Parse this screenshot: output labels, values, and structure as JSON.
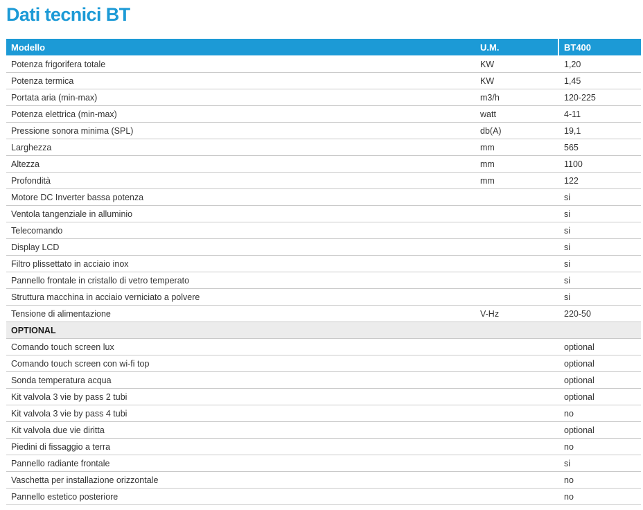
{
  "title": "Dati tecnici BT",
  "header": {
    "model": "Modello",
    "unit": "U.M.",
    "product": "BT400"
  },
  "specs": [
    {
      "label": "Potenza frigorifera totale",
      "unit": "KW",
      "value": "1,20"
    },
    {
      "label": "Potenza termica",
      "unit": "KW",
      "value": "1,45"
    },
    {
      "label": "Portata aria (min-max)",
      "unit": "m3/h",
      "value": "120-225"
    },
    {
      "label": "Potenza elettrica (min-max)",
      "unit": "watt",
      "value": "4-11"
    },
    {
      "label": "Pressione sonora minima (SPL)",
      "unit": "db(A)",
      "value": "19,1"
    },
    {
      "label": "Larghezza",
      "unit": "mm",
      "value": "565"
    },
    {
      "label": "Altezza",
      "unit": "mm",
      "value": "1100"
    },
    {
      "label": "Profondità",
      "unit": "mm",
      "value": "122"
    },
    {
      "label": "Motore DC Inverter bassa potenza",
      "unit": "",
      "value": "si"
    },
    {
      "label": "Ventola tangenziale in alluminio",
      "unit": "",
      "value": "si"
    },
    {
      "label": "Telecomando",
      "unit": "",
      "value": "si"
    },
    {
      "label": "Display LCD",
      "unit": "",
      "value": "si"
    },
    {
      "label": "Filtro plissettato in acciaio inox",
      "unit": "",
      "value": "si"
    },
    {
      "label": "Pannello frontale in cristallo di vetro temperato",
      "unit": "",
      "value": "si"
    },
    {
      "label": "Struttura macchina in acciaio verniciato a polvere",
      "unit": "",
      "value": "si"
    },
    {
      "label": "Tensione di alimentazione",
      "unit": "V-Hz",
      "value": "220-50"
    }
  ],
  "optional_section": "OPTIONAL",
  "optionals": [
    {
      "label": "Comando touch screen lux",
      "unit": "",
      "value": "optional"
    },
    {
      "label": "Comando touch screen con wi-fi top",
      "unit": "",
      "value": "optional"
    },
    {
      "label": "Sonda temperatura acqua",
      "unit": "",
      "value": "optional"
    },
    {
      "label": "Kit valvola 3 vie by pass 2 tubi",
      "unit": "",
      "value": "optional"
    },
    {
      "label": "Kit valvola 3 vie by pass 4 tubi",
      "unit": "",
      "value": "no"
    },
    {
      "label": "Kit valvola due vie diritta",
      "unit": "",
      "value": "optional"
    },
    {
      "label": "Piedini di fissaggio a terra",
      "unit": "",
      "value": "no"
    },
    {
      "label": "Pannello radiante frontale",
      "unit": "",
      "value": "si"
    },
    {
      "label": "Vaschetta per installazione orizzontale",
      "unit": "",
      "value": "no"
    },
    {
      "label": "Pannello estetico posteriore",
      "unit": "",
      "value": "no"
    }
  ],
  "colors": {
    "accent": "#1c9ad6",
    "section_bg": "#ececec",
    "row_border": "#c9c9c9"
  }
}
